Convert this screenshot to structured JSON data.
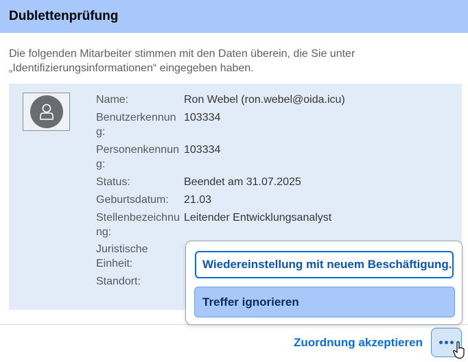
{
  "dialog": {
    "title": "Dublettenprüfung",
    "intro_line1": "Die folgenden Mitarbeiter stimmen mit den Daten überein, die Sie unter",
    "intro_line2": "„Identifizierungsinformationen“ eingegeben haben."
  },
  "employee": {
    "avatar_icon": "person-icon",
    "fields": [
      {
        "label": "Name:",
        "value": "Ron Webel (ron.webel@oida.icu)"
      },
      {
        "label": "Benutzerkennung:",
        "value": "103334"
      },
      {
        "label": "Personenkennung:",
        "value": "103334"
      },
      {
        "label": "Status:",
        "value": "Beendet am 31.07.2025"
      },
      {
        "label": "Geburtsdatum:",
        "value": "21.03"
      },
      {
        "label": "Stellenbezeichnung:",
        "value": "Leitender Entwicklungsanalyst"
      },
      {
        "label": "Juristische Einheit:",
        "value": ""
      },
      {
        "label": "Standort:",
        "value": ""
      }
    ]
  },
  "footer": {
    "accept_label": "Zuordnung akzeptieren",
    "overflow_icon": "more-dots-icon"
  },
  "popover": {
    "items": [
      {
        "label": "Wiedereinstellung mit neuem Beschäftigung..."
      },
      {
        "label": "Treffer ignorieren"
      }
    ]
  },
  "colors": {
    "header_bg": "#a8c7fa",
    "card_bg": "#e2ecf8",
    "accent": "#0a6ed1"
  }
}
